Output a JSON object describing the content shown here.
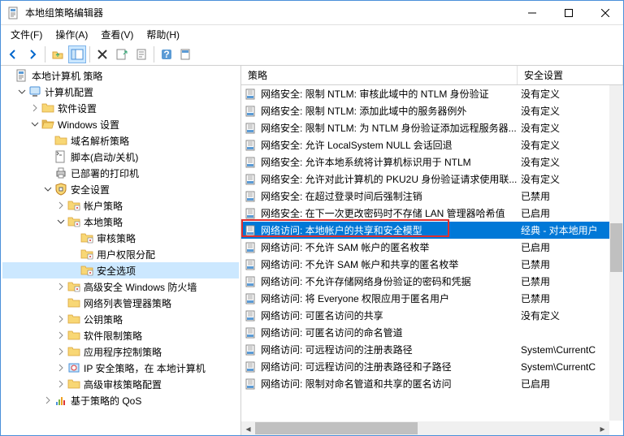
{
  "titlebar": {
    "title": "本地组策略编辑器"
  },
  "menubar": {
    "items": [
      "文件(F)",
      "操作(A)",
      "查看(V)",
      "帮助(H)"
    ]
  },
  "tree": {
    "root": "本地计算机 策略",
    "nodes": [
      {
        "level": 1,
        "expanded": true,
        "icon": "computer",
        "label": "计算机配置"
      },
      {
        "level": 2,
        "expanded": false,
        "icon": "folder",
        "label": "软件设置"
      },
      {
        "level": 2,
        "expanded": true,
        "icon": "folder-open",
        "label": "Windows 设置"
      },
      {
        "level": 3,
        "expanded": null,
        "icon": "folder",
        "label": "域名解析策略"
      },
      {
        "level": 3,
        "expanded": null,
        "icon": "script",
        "label": "脚本(启动/关机)"
      },
      {
        "level": 3,
        "expanded": null,
        "icon": "printer",
        "label": "已部署的打印机"
      },
      {
        "level": 3,
        "expanded": true,
        "icon": "security",
        "label": "安全设置"
      },
      {
        "level": 4,
        "expanded": false,
        "icon": "folder-s",
        "label": "帐户策略"
      },
      {
        "level": 4,
        "expanded": true,
        "icon": "folder-s",
        "label": "本地策略"
      },
      {
        "level": 5,
        "expanded": null,
        "icon": "folder-s",
        "label": "审核策略"
      },
      {
        "level": 5,
        "expanded": null,
        "icon": "folder-s",
        "label": "用户权限分配"
      },
      {
        "level": 5,
        "expanded": null,
        "icon": "folder-s",
        "label": "安全选项",
        "selected": true
      },
      {
        "level": 4,
        "expanded": false,
        "icon": "folder-s",
        "label": "高级安全 Windows 防火墙"
      },
      {
        "level": 4,
        "expanded": null,
        "icon": "folder",
        "label": "网络列表管理器策略"
      },
      {
        "level": 4,
        "expanded": false,
        "icon": "folder",
        "label": "公钥策略"
      },
      {
        "level": 4,
        "expanded": false,
        "icon": "folder",
        "label": "软件限制策略"
      },
      {
        "level": 4,
        "expanded": false,
        "icon": "folder",
        "label": "应用程序控制策略"
      },
      {
        "level": 4,
        "expanded": false,
        "icon": "ipsec",
        "label": "IP 安全策略，在 本地计算机"
      },
      {
        "level": 4,
        "expanded": false,
        "icon": "folder",
        "label": "高级审核策略配置"
      },
      {
        "level": 3,
        "expanded": false,
        "icon": "qos",
        "label": "基于策略的 QoS"
      }
    ]
  },
  "list": {
    "headers": {
      "c1": "策略",
      "c2": "安全设置"
    },
    "rows": [
      {
        "policy": "网络安全: 限制 NTLM: 审核此域中的 NTLM 身份验证",
        "setting": "没有定义"
      },
      {
        "policy": "网络安全: 限制 NTLM: 添加此域中的服务器例外",
        "setting": "没有定义"
      },
      {
        "policy": "网络安全: 限制 NTLM: 为 NTLM 身份验证添加远程服务器...",
        "setting": "没有定义"
      },
      {
        "policy": "网络安全: 允许 LocalSystem NULL 会话回退",
        "setting": "没有定义"
      },
      {
        "policy": "网络安全: 允许本地系统将计算机标识用于 NTLM",
        "setting": "没有定义"
      },
      {
        "policy": "网络安全: 允许对此计算机的 PKU2U 身份验证请求使用联...",
        "setting": "没有定义"
      },
      {
        "policy": "网络安全: 在超过登录时间后强制注销",
        "setting": "已禁用"
      },
      {
        "policy": "网络安全: 在下一次更改密码时不存储 LAN 管理器哈希值",
        "setting": "已启用"
      },
      {
        "policy": "网络访问: 本地帐户的共享和安全模型",
        "setting": "经典 - 对本地用户",
        "selected": true,
        "boxed": true
      },
      {
        "policy": "网络访问: 不允许 SAM 帐户的匿名枚举",
        "setting": "已启用"
      },
      {
        "policy": "网络访问: 不允许 SAM 帐户和共享的匿名枚举",
        "setting": "已禁用"
      },
      {
        "policy": "网络访问: 不允许存储网络身份验证的密码和凭据",
        "setting": "已禁用"
      },
      {
        "policy": "网络访问: 将 Everyone 权限应用于匿名用户",
        "setting": "已禁用"
      },
      {
        "policy": "网络访问: 可匿名访问的共享",
        "setting": "没有定义"
      },
      {
        "policy": "网络访问: 可匿名访问的命名管道",
        "setting": ""
      },
      {
        "policy": "网络访问: 可远程访问的注册表路径",
        "setting": "System\\CurrentC"
      },
      {
        "policy": "网络访问: 可远程访问的注册表路径和子路径",
        "setting": "System\\CurrentC"
      },
      {
        "policy": "网络访问: 限制对命名管道和共享的匿名访问",
        "setting": "已启用"
      }
    ]
  }
}
